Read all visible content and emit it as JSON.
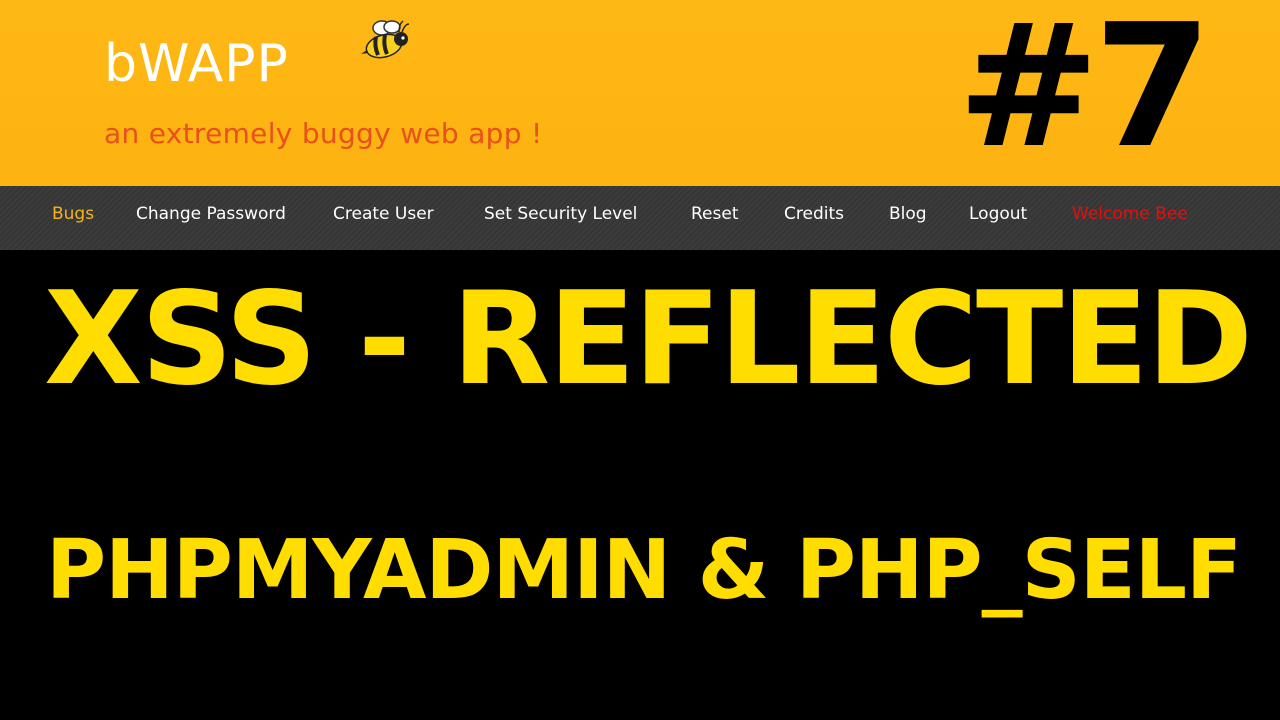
{
  "header": {
    "logo_text": "bWAPP",
    "tagline": "an extremely buggy web app !",
    "episode_number": "#7",
    "logo_icon": "bee-icon"
  },
  "nav": {
    "items": [
      {
        "label": "Bugs"
      },
      {
        "label": "Change Password"
      },
      {
        "label": "Create User"
      },
      {
        "label": "Set Security Level"
      },
      {
        "label": "Reset"
      },
      {
        "label": "Credits"
      },
      {
        "label": "Blog"
      },
      {
        "label": "Logout"
      }
    ],
    "welcome": "Welcome Bee"
  },
  "main": {
    "title": "XSS - REFLECTED",
    "subtitle": "PHPMYADMIN & PHP_SELF"
  },
  "colors": {
    "header_bg": "#FDB714",
    "tagline": "#E8511B",
    "nav_bg": "#3a3a3a",
    "nav_active": "#F2B51A",
    "welcome": "#E01010",
    "title": "#FFDD00",
    "background": "#000000"
  }
}
